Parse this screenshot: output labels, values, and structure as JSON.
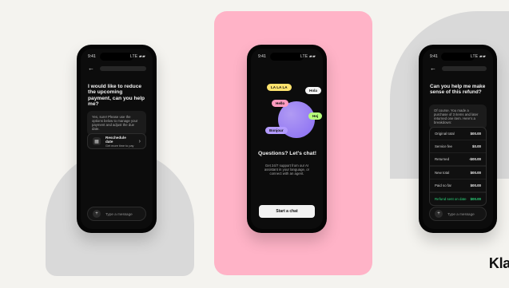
{
  "brand": {
    "text": "Kla"
  },
  "status": {
    "time": "9:41",
    "right": "LTE ▰▰"
  },
  "phones": {
    "left": {
      "title": "I would like to reduce the upcoming payment, can you help me?",
      "message": "Yes, sure! Please use the options below to manage your payment and adjust the due date.",
      "cta": {
        "title": "Reschedule date",
        "subtitle": "Get more time to pay"
      },
      "input_placeholder": "Type a message"
    },
    "middle": {
      "tags": [
        {
          "text": "LA LA LA",
          "color": "yellow"
        },
        {
          "text": "Hola",
          "color": "white"
        },
        {
          "text": "Hello",
          "color": "pink"
        },
        {
          "text": "Hej",
          "color": "green"
        },
        {
          "text": "Bonjour",
          "color": "purple"
        }
      ],
      "title": "Questions? Let's chat!",
      "body": "Get 24/7 support from our AI assistant in your language, or connect with an agent.",
      "button": "Start a chat"
    },
    "right": {
      "title": "Can you help me make sense of this refund?",
      "message": "Of course. You made a purchase of 3 items and later returned one item. Here's a breakdown:",
      "rows": [
        {
          "k": "Original total",
          "v": "$00.00"
        },
        {
          "k": "Service fee",
          "v": "$0.00"
        },
        {
          "k": "Returned",
          "v": "-$00.00"
        },
        {
          "k": "New total",
          "v": "$00.00"
        },
        {
          "k": "Paid so far",
          "v": "$00.00"
        },
        {
          "k": "Refund sent on date",
          "v": "$00.00",
          "highlight": true
        }
      ],
      "input_placeholder": "Type a message"
    }
  }
}
